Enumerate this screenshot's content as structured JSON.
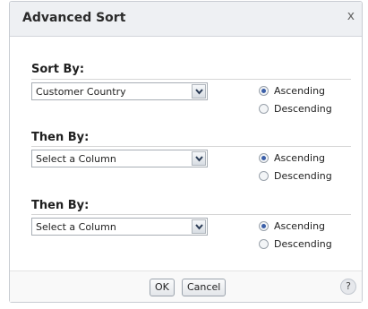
{
  "dialog": {
    "title": "Advanced Sort",
    "close_label": "x"
  },
  "sections": [
    {
      "label": "Sort By:",
      "selected": "Customer Country",
      "options": [
        "Ascending",
        "Descending"
      ],
      "selected_option": "Ascending"
    },
    {
      "label": "Then By:",
      "selected": "Select a Column",
      "options": [
        "Ascending",
        "Descending"
      ],
      "selected_option": "Ascending"
    },
    {
      "label": "Then By:",
      "selected": "Select a Column",
      "options": [
        "Ascending",
        "Descending"
      ],
      "selected_option": "Ascending"
    }
  ],
  "footer": {
    "ok_label": "OK",
    "cancel_label": "Cancel",
    "help_label": "?"
  },
  "icons": {
    "dropdown": "chevron-down-icon",
    "close": "close-icon",
    "help": "help-icon"
  }
}
